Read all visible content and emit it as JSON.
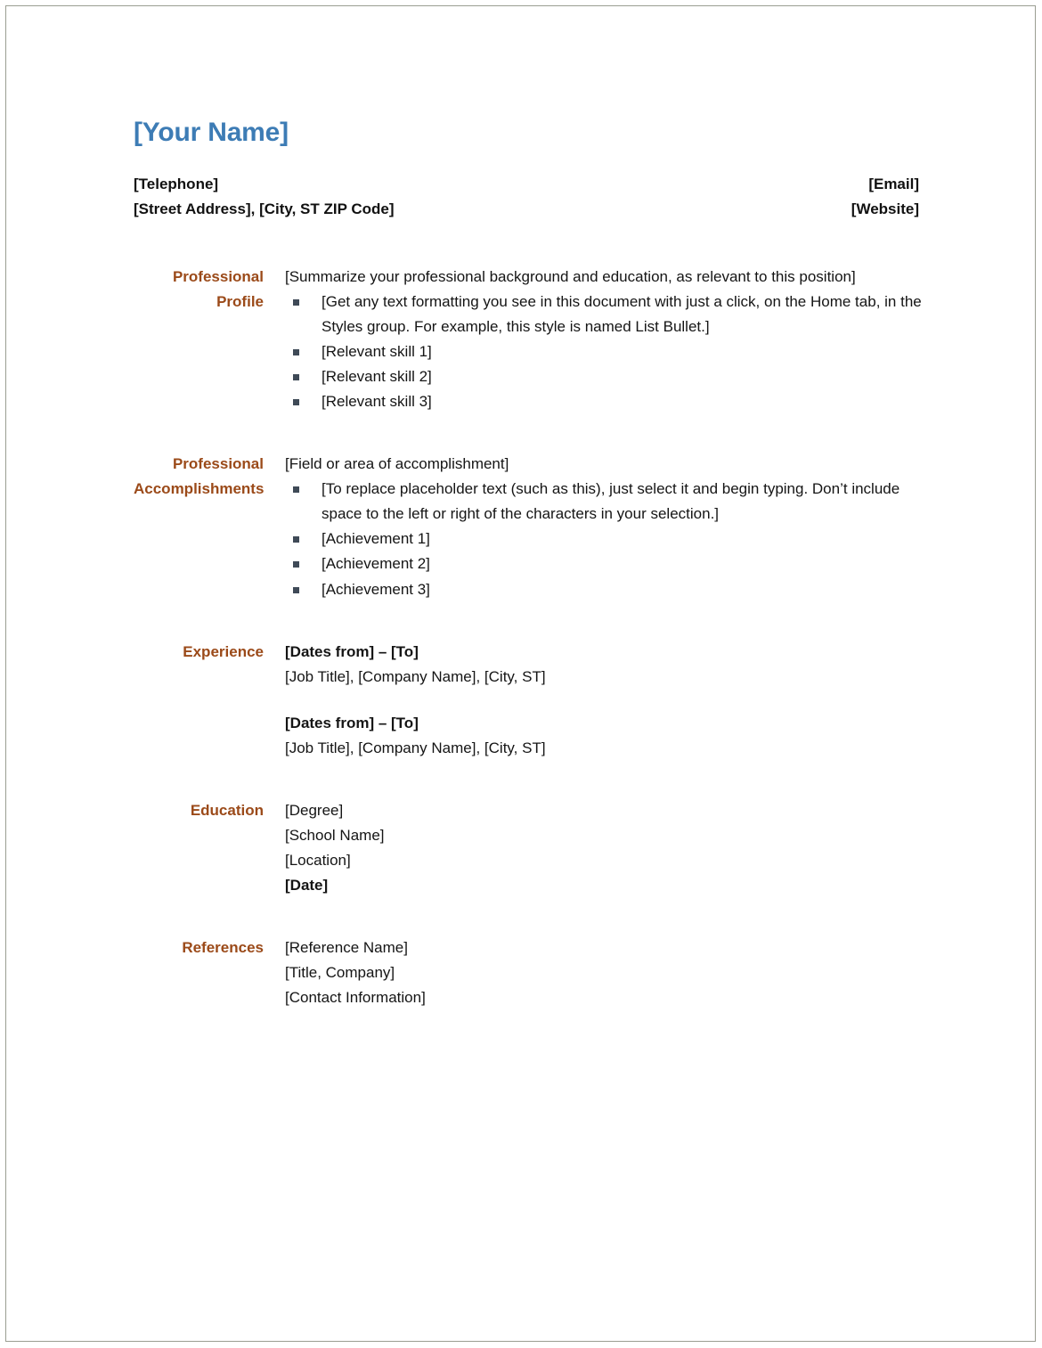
{
  "document": {
    "type": "resume-template",
    "accent_heading_color": "#9b4a19",
    "name_color": "#3d7cb5",
    "bullet_color": "#3f4a57",
    "page_border_color": "#9a9e92"
  },
  "header": {
    "name": "[Your Name]",
    "telephone": "[Telephone]",
    "email": "[Email]",
    "address": "[Street Address], [City, ST ZIP Code]",
    "website": "[Website]"
  },
  "sections": {
    "profile": {
      "label": "Professional\nProfile",
      "summary": "[Summarize your professional background and education, as relevant to this position]",
      "bullets": [
        "[Get any text formatting you see in this document with just a click, on the Home tab, in the Styles group. For example, this style is named List Bullet.]",
        "[Relevant skill 1]",
        "[Relevant skill 2]",
        "[Relevant skill 3]"
      ]
    },
    "accomplishments": {
      "label": "Professional\nAccomplishments",
      "field": "[Field or area of accomplishment]",
      "bullets": [
        "[To replace placeholder text (such as this), just select it and begin typing. Don’t include space to the left or right of the characters in your selection.]",
        "[Achievement 1]",
        "[Achievement 2]",
        "[Achievement 3]"
      ]
    },
    "experience": {
      "label": "Experience",
      "entries": [
        {
          "dates": "[Dates from] – [To]",
          "detail": "[Job Title], [Company Name], [City, ST]"
        },
        {
          "dates": "[Dates from] – [To]",
          "detail": "[Job Title], [Company Name], [City, ST]"
        }
      ]
    },
    "education": {
      "label": "Education",
      "degree": "[Degree]",
      "school": "[School Name]",
      "location": "[Location]",
      "date": "[Date]"
    },
    "references": {
      "label": "References",
      "name": "[Reference Name]",
      "title_company": "[Title, Company]",
      "contact": "[Contact Information]"
    }
  }
}
